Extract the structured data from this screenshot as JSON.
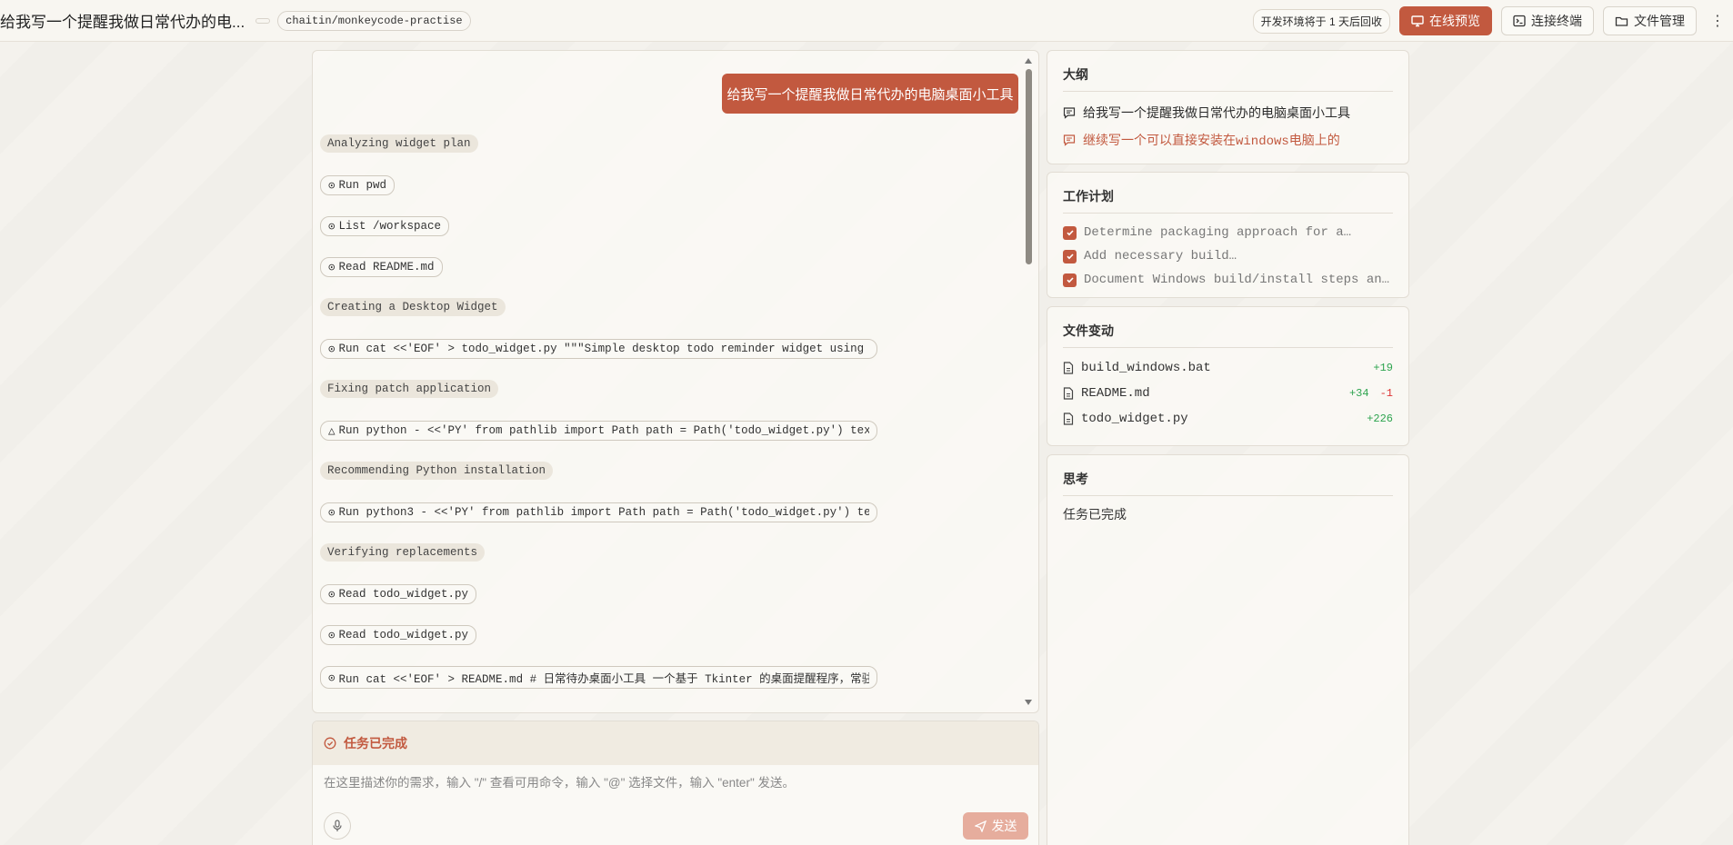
{
  "header": {
    "title": "给我写一个提醒我做日常代办的电...",
    "repo": "chaitin/monkeycode-practise",
    "env_notice": "开发环境将于 1 天后回收",
    "preview_label": "在线预览",
    "terminal_label": "连接终端",
    "files_label": "文件管理",
    "more_label": "⋮"
  },
  "chat": {
    "user_message": "给我写一个提醒我做日常代办的电脑桌面小工具",
    "items": [
      {
        "kind": "stage",
        "text": "Analyzing widget plan"
      },
      {
        "kind": "tool",
        "icon": "check-circle-icon",
        "text": "Run pwd"
      },
      {
        "kind": "tool",
        "icon": "check-circle-icon",
        "text": "List /workspace"
      },
      {
        "kind": "tool",
        "icon": "check-circle-icon",
        "text": "Read README.md"
      },
      {
        "kind": "stage",
        "text": "Creating a Desktop Widget"
      },
      {
        "kind": "tool",
        "icon": "check-circle-icon",
        "text": "Run cat <<'EOF' > todo_widget.py \"\"\"Simple desktop todo reminder widget using T…"
      },
      {
        "kind": "stage",
        "text": "Fixing patch application"
      },
      {
        "kind": "tool",
        "icon": "warning-icon",
        "text": "Run python - <<'PY' from pathlib import Path path = Path('todo_widget.py') text…"
      },
      {
        "kind": "stage",
        "text": "Recommending Python installation"
      },
      {
        "kind": "tool",
        "icon": "check-circle-icon",
        "text": "Run python3 - <<'PY' from pathlib import Path path = Path('todo_widget.py') tex…"
      },
      {
        "kind": "stage",
        "text": "Verifying replacements"
      },
      {
        "kind": "tool",
        "icon": "check-circle-icon",
        "text": "Read todo_widget.py"
      },
      {
        "kind": "tool",
        "icon": "check-circle-icon",
        "text": "Read todo_widget.py"
      },
      {
        "kind": "tool",
        "icon": "check-circle-icon",
        "text": "Run cat <<'EOF' > README.md # 日常待办桌面小工具 一个基于 Tkinter 的桌面提醒程序，常驻…"
      }
    ]
  },
  "input": {
    "status": "任务已完成",
    "placeholder": "在这里描述你的需求，输入 \"/\" 查看可用命令，输入 \"@\" 选择文件，输入 \"enter\" 发送。",
    "send_label": "发送"
  },
  "outline": {
    "title": "大纲",
    "items": [
      "给我写一个提醒我做日常代办的电脑桌面小工具",
      "继续写一个可以直接安装在windows电脑上的"
    ]
  },
  "plan": {
    "title": "工作计划",
    "items": [
      "Determine packaging approach for a…",
      "Add necessary build…",
      "Document Windows build/install steps an…"
    ]
  },
  "files": {
    "title": "文件变动",
    "items": [
      {
        "name": "build_windows.bat",
        "add": "+19",
        "del": ""
      },
      {
        "name": "README.md",
        "add": "+34",
        "del": "-1"
      },
      {
        "name": "todo_widget.py",
        "add": "+226",
        "del": ""
      }
    ]
  },
  "thinking": {
    "title": "思考",
    "text": "任务已完成"
  },
  "colors": {
    "accent": "#c2593f",
    "add": "#2ea44f",
    "del": "#dd3333"
  }
}
